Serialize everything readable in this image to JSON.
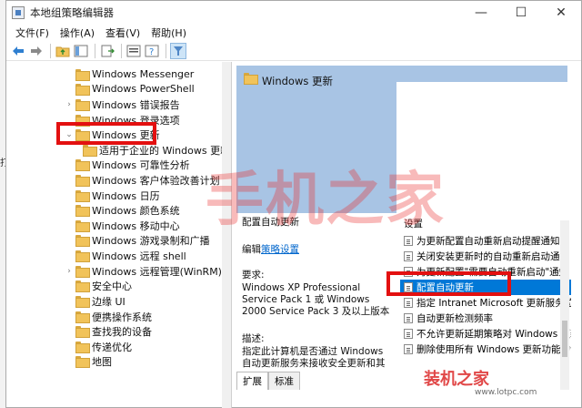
{
  "window": {
    "title": "本地组策略编辑器",
    "controls": {
      "minimize": "—",
      "maximize": "☐",
      "close": "✕"
    }
  },
  "menu": [
    "文件(F)",
    "操作(A)",
    "查看(V)",
    "帮助(H)"
  ],
  "toolbar_icons": [
    "back-arrow-icon",
    "forward-arrow-icon",
    "folder-up-icon",
    "show-hide-tree-icon",
    "export-list-icon",
    "properties-icon",
    "help-icon",
    "filter-icon"
  ],
  "tree": {
    "items": [
      "Windows Messenger",
      "Windows PowerShell",
      "Windows 错误报告",
      "Windows 登录选项",
      "Windows 更新",
      "适用于企业的 Windows 更新",
      "Windows 可靠性分析",
      "Windows 客户体验改善计划",
      "Windows 日历",
      "Windows 颜色系统",
      "Windows 移动中心",
      "Windows 游戏录制和广播",
      "Windows 远程 shell",
      "Windows 远程管理(WinRM)",
      "安全中心",
      "边缘 UI",
      "便携操作系统",
      "查找我的设备",
      "传递优化",
      "地图"
    ]
  },
  "detail": {
    "header_title": "Windows 更新",
    "policy_title": "配置自动更新",
    "edit_prefix": "编辑",
    "edit_link": "策略设置",
    "requirements_label": "要求:",
    "requirements": "Windows XP Professional Service Pack 1 或 Windows 2000 Service Pack 3 及以上版本",
    "description_label": "描述:",
    "description": "指定此计算机是否通过 Windows 自动更新服务来接收安全更新和其"
  },
  "settings": {
    "header": "设置",
    "rows": [
      "为更新配置自动重新启动提醒通知",
      "关闭安装更新时的自动重新启动通知",
      "为更新配置\"需要自动重新启动\"通知",
      "配置自动更新",
      "指定 Intranet Microsoft 更新服务位置",
      "自动更新检测频率",
      "不允许更新延期策略对 Windows 更新",
      "删除使用所有 Windows 更新功能的访"
    ],
    "selected_index": 3
  },
  "tabs": [
    "扩展",
    "标准"
  ],
  "watermark": {
    "big": "手机之家",
    "brand": "装机之家",
    "url": "www.lotpc.com"
  },
  "desk_glyph": "打"
}
